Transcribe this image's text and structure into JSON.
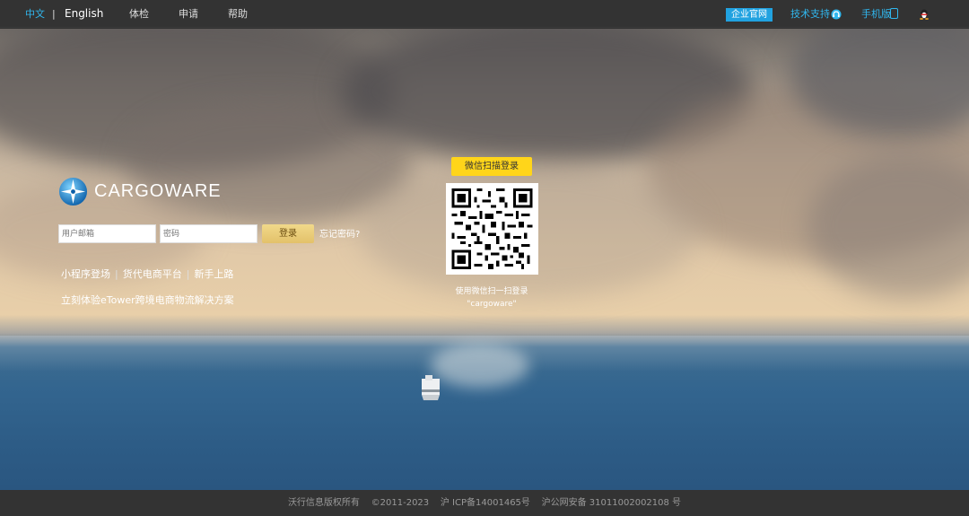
{
  "topbar": {
    "lang_zh": "中文",
    "lang_sep": "|",
    "lang_en": "English",
    "nav": [
      "体检",
      "申请",
      "帮助"
    ],
    "site_button": "企业官网",
    "support": "技术支持",
    "mobile": "手机版",
    "icons": {
      "support": "headset-icon",
      "mobile": "phone-icon",
      "qq": "qq-penguin-icon"
    }
  },
  "brand": {
    "logo_text": "CARGOWARE",
    "logo_icon": "compass-star-icon"
  },
  "login": {
    "username_placeholder": "用户邮箱",
    "password_placeholder": "密码",
    "submit_label": "登录",
    "forgot_label": "忘记密码?"
  },
  "links": [
    "小程序登场",
    "货代电商平台",
    "新手上路"
  ],
  "links_sep": "|",
  "promo": "立刻体验eTower跨境电商物流解决方案",
  "qr": {
    "title": "微信扫描登录",
    "caption_line1": "使用微信扫一扫登录",
    "caption_line2": "\"cargoware\""
  },
  "footer": {
    "text": "沃行信息版权所有    ©2011-2023    沪 ICP备14001465号    沪公网安备 31011002002108 号"
  },
  "colors": {
    "accent": "#30b7ee",
    "qr_title_bg": "#ffd51a",
    "login_button": "#e3c16a",
    "bar_bg": "#333333"
  }
}
